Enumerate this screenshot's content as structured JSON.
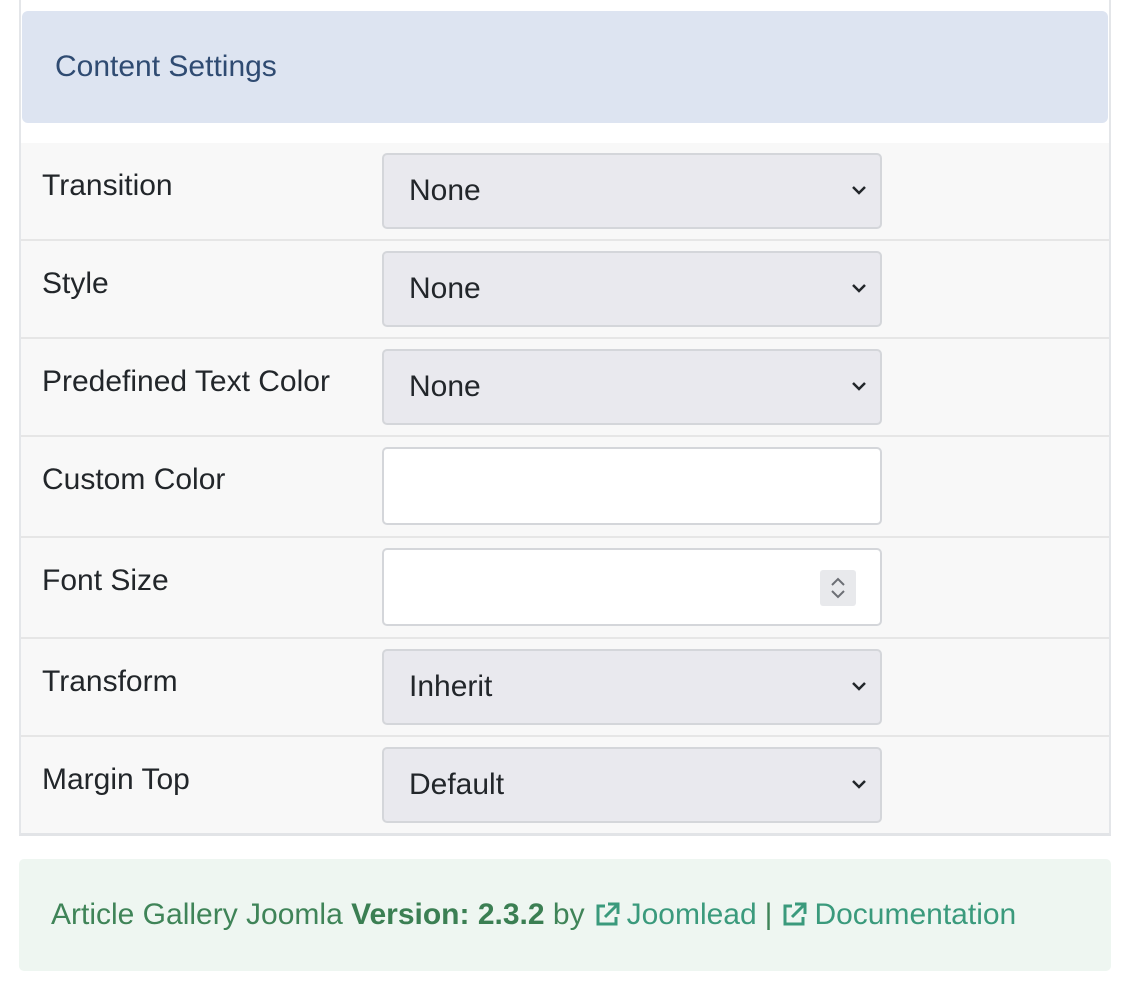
{
  "header": {
    "title": "Content Settings"
  },
  "rows": [
    {
      "label": "Transition",
      "type": "select",
      "value": "None"
    },
    {
      "label": "Style",
      "type": "select",
      "value": "None"
    },
    {
      "label": "Predefined Text Color",
      "type": "select",
      "value": "None"
    },
    {
      "label": "Custom Color",
      "type": "text",
      "value": ""
    },
    {
      "label": "Font Size",
      "type": "number",
      "value": ""
    },
    {
      "label": "Transform",
      "type": "select",
      "value": "Inherit"
    },
    {
      "label": "Margin Top",
      "type": "select",
      "value": "Default"
    }
  ],
  "footer": {
    "product": "Article Gallery Joomla",
    "version_label": "Version: 2.3.2",
    "by": "by",
    "author_link": "Joomlead",
    "separator": "|",
    "docs_link": "Documentation",
    "link_icon": "external-link-icon"
  },
  "colors": {
    "header_bg": "#dde4f1",
    "header_text": "#2f4b72",
    "footer_bg": "#eef6f1",
    "footer_text": "#3f8458",
    "link": "#3a9a7c"
  }
}
